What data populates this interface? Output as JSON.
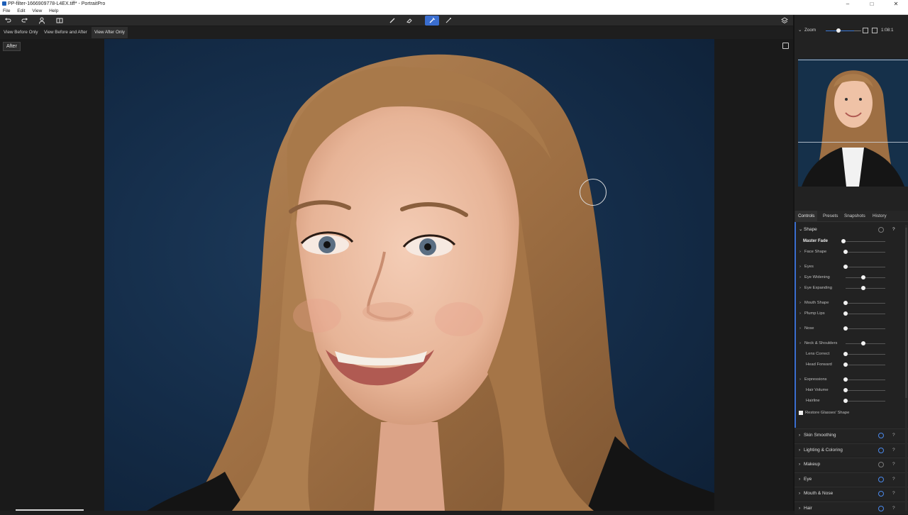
{
  "window": {
    "title": "PP-filter-1666909778-L4EX.tiff* - PortraitPro",
    "minimize": "‒",
    "maximize": "□",
    "close": "✕"
  },
  "menu": {
    "items": [
      "File",
      "Edit",
      "View",
      "Help"
    ]
  },
  "toolbar": {
    "icons": [
      "undo-icon",
      "redo-icon",
      "person-icon",
      "compare-icon",
      "brush-icon",
      "eraser-icon",
      "wand-brush-icon",
      "pen-icon",
      "layers-icon"
    ],
    "active_tool": "wand-brush-icon"
  },
  "view_tabs": {
    "before_only": "View Before Only",
    "before_after": "View Before and After",
    "after_only": "View After Only",
    "active": "after_only"
  },
  "canvas": {
    "label": "After"
  },
  "zoom": {
    "label": "Zoom",
    "value": "1:08:1",
    "level": 0.45
  },
  "panel_tabs": {
    "controls": "Controls",
    "presets": "Presets",
    "snapshots": "Snapshots",
    "history": "History",
    "active": "controls"
  },
  "shape": {
    "header": "Shape",
    "help": "?",
    "rows": [
      {
        "label": "Master Fade",
        "value": 0.0
      },
      {
        "label": "Face Shape",
        "value": 0.05
      },
      {
        "label": "Eyes",
        "value": 0.05
      },
      {
        "label": "Eye Widening",
        "value": 0.5
      },
      {
        "label": "Eye Expanding",
        "value": 0.5
      },
      {
        "label": "Mouth Shape",
        "value": 0.05
      },
      {
        "label": "Plump Lips",
        "value": 0.05
      },
      {
        "label": "Nose",
        "value": 0.05
      },
      {
        "label": "Neck & Shoulders",
        "value": 0.5
      },
      {
        "label": "Lens Correct",
        "value": 0.05
      },
      {
        "label": "Head Forward",
        "value": 0.05
      },
      {
        "label": "Expressions",
        "value": 0.05
      },
      {
        "label": "Hair Volume",
        "value": 0.05
      },
      {
        "label": "Hairline",
        "value": 0.05
      }
    ],
    "restore_glasses": "Restore Glasses' Shape"
  },
  "sections": [
    {
      "label": "Skin Smoothing",
      "on": true
    },
    {
      "label": "Lighting & Coloring",
      "on": true
    },
    {
      "label": "Makeup",
      "on": false
    },
    {
      "label": "Eye",
      "on": true
    },
    {
      "label": "Mouth & Nose",
      "on": true
    },
    {
      "label": "Hair",
      "on": true
    }
  ],
  "colors": {
    "accent": "#3a6ed0",
    "background": "#14263b",
    "hair": "#a87a4d",
    "skin": "#ecc1a8"
  }
}
